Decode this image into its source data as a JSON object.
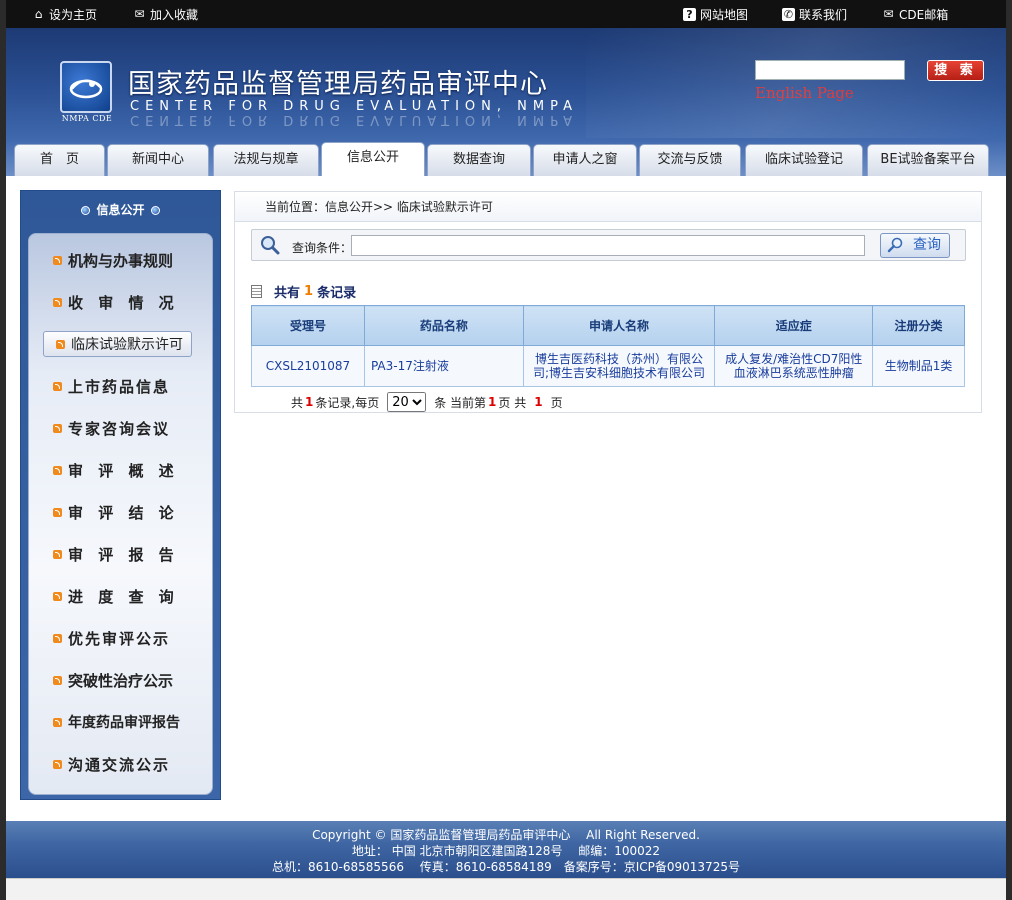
{
  "topbar": {
    "set_home": "设为主页",
    "add_favorite": "加入收藏",
    "sitemap": "网站地图",
    "contact": "联系我们",
    "cde_mail": "CDE邮箱"
  },
  "header": {
    "logo_text": "NMPA CDE",
    "title": "国家药品监督管理局药品审评中心",
    "subtitle": "CENTER FOR DRUG EVALUATION, NMPA",
    "search_button": "搜 索",
    "english_link": "English Page"
  },
  "nav": {
    "tabs": [
      {
        "label": "首　页"
      },
      {
        "label": "新闻中心"
      },
      {
        "label": "法规与规章"
      },
      {
        "label": "信息公开"
      },
      {
        "label": "数据查询"
      },
      {
        "label": "申请人之窗"
      },
      {
        "label": "交流与反馈"
      },
      {
        "label": "临床试验登记"
      },
      {
        "label": "BE试验备案平台"
      }
    ],
    "active_tab": "信息公开"
  },
  "sidebar": {
    "heading": "信息公开",
    "items": [
      {
        "label": "机构与办事规则"
      },
      {
        "label": "收 审 情 况"
      },
      {
        "label": "临床试验默示许可"
      },
      {
        "label": "上市药品信息"
      },
      {
        "label": "专家咨询会议"
      },
      {
        "label": "审 评 概 述"
      },
      {
        "label": "审 评 结 论"
      },
      {
        "label": "审 评 报 告"
      },
      {
        "label": "进 度 查 询"
      },
      {
        "label": "优先审评公示"
      },
      {
        "label": "突破性治疗公示"
      },
      {
        "label": "年度药品审评报告"
      },
      {
        "label": "沟通交流公示"
      }
    ],
    "active_item": "临床试验默示许可"
  },
  "main": {
    "breadcrumb": "当前位置：信息公开>> 临床试验默示许可",
    "query_label": "查询条件：",
    "query_value": "",
    "query_button": "查询",
    "summary_prefix": "共有",
    "summary_count": "1",
    "summary_suffix": "条记录",
    "table": {
      "headers": [
        "受理号",
        "药品名称",
        "申请人名称",
        "适应症",
        "注册分类"
      ],
      "rows": [
        [
          "CXSL2101087",
          "PA3-17注射液",
          "博生吉医药科技（苏州）有限公司;博生吉安科细胞技术有限公司",
          "成人复发/难治性CD7阳性血液淋巴系统恶性肿瘤",
          "生物制品1类"
        ]
      ]
    },
    "pager": {
      "p1": "共",
      "total": "1",
      "p2": "条记录,每页",
      "page_size": "20",
      "p3": "条 当前第",
      "current": "1",
      "p4": "页 共",
      "pages": "1",
      "p5": "页"
    }
  },
  "footer": {
    "line1": "Copyright © 国家药品监督管理局药品审评中心　 All Right Reserved.",
    "line2": "地址：  中国  北京市朝阳区建国路128号　 邮编：100022",
    "line3": "总机：8610-68585566　 传真：8610-68584189　备案序号：京ICP备09013725号"
  }
}
